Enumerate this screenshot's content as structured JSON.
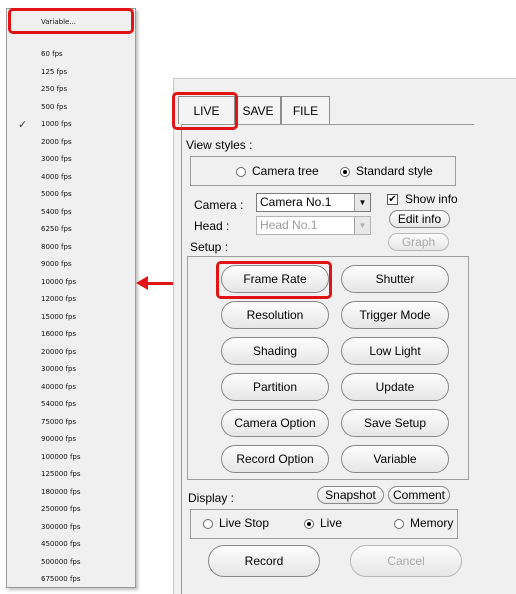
{
  "menu": {
    "variable_label": "Variable...",
    "checked_item": "1000 fps",
    "items": [
      "60 fps",
      "125 fps",
      "250 fps",
      "500 fps",
      "1000 fps",
      "2000 fps",
      "3000 fps",
      "4000 fps",
      "5000 fps",
      "5400 fps",
      "6250 fps",
      "8000 fps",
      "9000 fps",
      "10000 fps",
      "12000 fps",
      "15000 fps",
      "16000 fps",
      "20000 fps",
      "30000 fps",
      "40000 fps",
      "54000 fps",
      "75000 fps",
      "90000 fps",
      "100000 fps",
      "125000 fps",
      "180000 fps",
      "250000 fps",
      "300000 fps",
      "450000 fps",
      "500000 fps",
      "675000 fps"
    ],
    "check_glyph": "✓"
  },
  "tabs": {
    "live": "LIVE",
    "save": "SAVE",
    "file": "FILE",
    "active": "LIVE"
  },
  "view_styles": {
    "label": "View styles :",
    "options": [
      "Camera tree",
      "Standard style"
    ],
    "selected": "Standard style"
  },
  "camera": {
    "label": "Camera :",
    "value": "Camera No.1",
    "head_label": "Head :",
    "head_value": "Head No.1",
    "show_info_label": "Show info",
    "show_info_checked": true,
    "edit_info_label": "Edit info",
    "graph_label": "Graph"
  },
  "setup": {
    "label": "Setup :",
    "buttons": [
      "Frame Rate",
      "Shutter",
      "Resolution",
      "Trigger Mode",
      "Shading",
      "Low Light",
      "Partition",
      "Update",
      "Camera Option",
      "Save Setup",
      "Record Option",
      "Variable"
    ]
  },
  "display": {
    "label": "Display :",
    "snapshot_label": "Snapshot",
    "comment_label": "Comment",
    "options": [
      "Live Stop",
      "Live",
      "Memory"
    ],
    "selected": "Live",
    "record_label": "Record",
    "cancel_label": "Cancel"
  },
  "colors": {
    "highlight": "#e01414",
    "panel_bg": "#f0f0f0"
  }
}
